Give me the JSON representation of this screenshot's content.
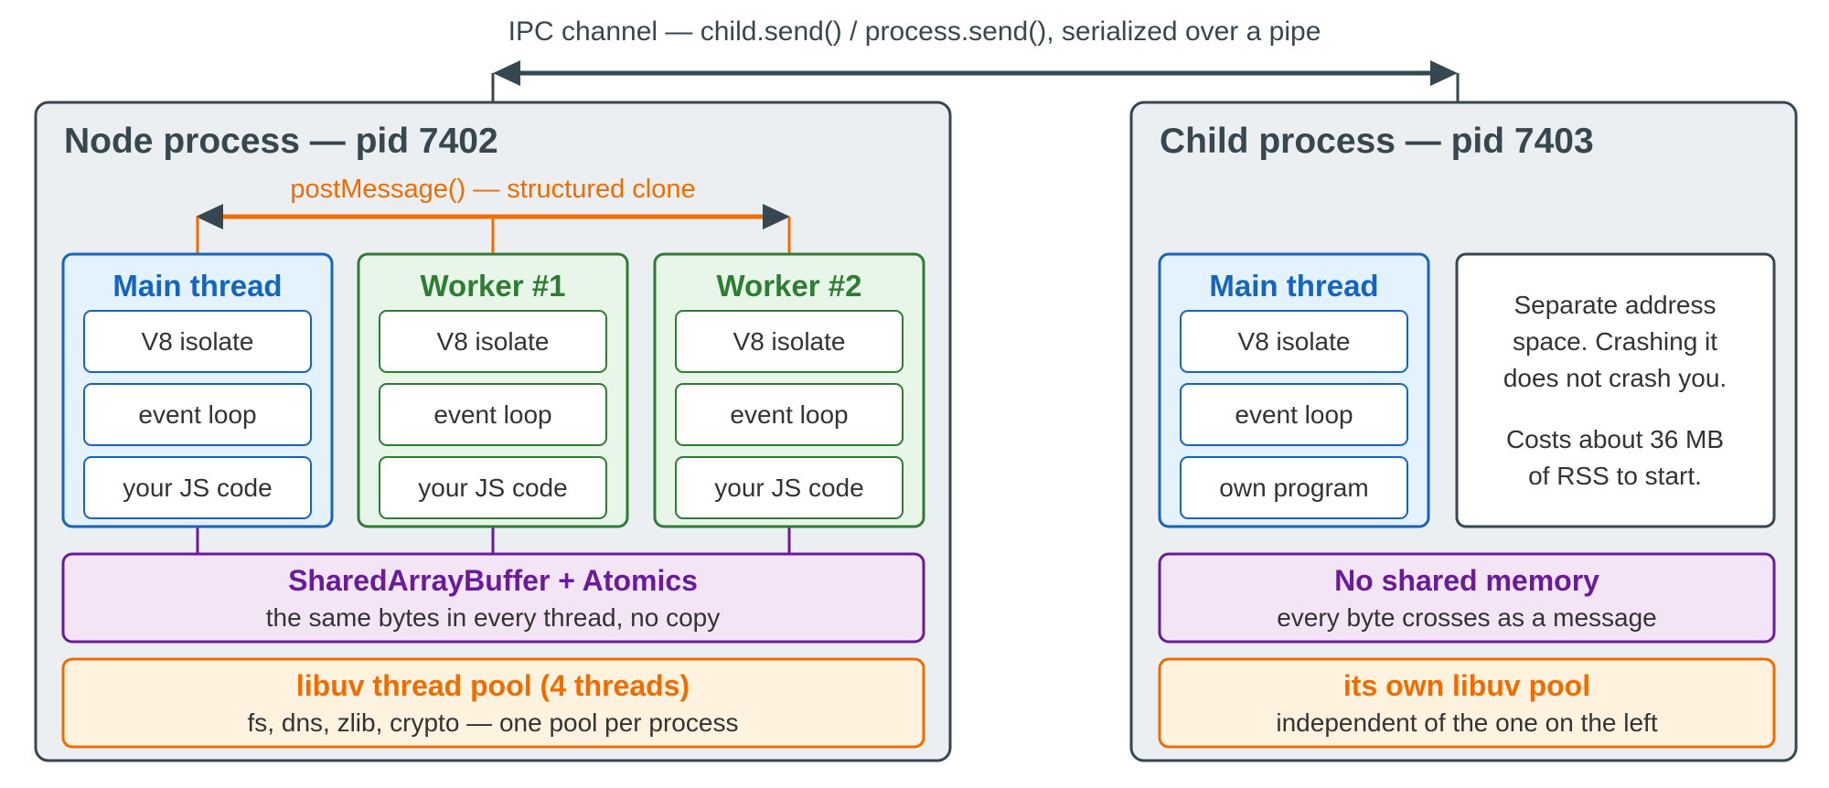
{
  "ipc_label": "IPC channel — child.send() / process.send(), serialized over a pipe",
  "postmessage_label": "postMessage() — structured clone",
  "node_process": {
    "title": "Node process — pid 7402",
    "threads": [
      {
        "title": "Main thread",
        "items": [
          "V8 isolate",
          "event loop",
          "your JS code"
        ]
      },
      {
        "title": "Worker #1",
        "items": [
          "V8 isolate",
          "event loop",
          "your JS code"
        ]
      },
      {
        "title": "Worker #2",
        "items": [
          "V8 isolate",
          "event loop",
          "your JS code"
        ]
      }
    ],
    "shared_memory": {
      "title": "SharedArrayBuffer + Atomics",
      "subtitle": "the same bytes in every thread, no copy"
    },
    "thread_pool": {
      "title": "libuv thread pool (4 threads)",
      "subtitle": "fs, dns, zlib, crypto — one pool per process"
    }
  },
  "child_process": {
    "title": "Child process — pid 7403",
    "main_thread": {
      "title": "Main thread",
      "items": [
        "V8 isolate",
        "event loop",
        "own program"
      ]
    },
    "note": {
      "para1": [
        "Separate address",
        "space. Crashing it",
        "does not crash you."
      ],
      "para2": [
        "Costs about 36 MB",
        "of RSS to start."
      ]
    },
    "shared_memory": {
      "title": "No shared memory",
      "subtitle": "every byte crosses as a message"
    },
    "thread_pool": {
      "title": "its own libuv pool",
      "subtitle": "independent of the one on the left"
    }
  },
  "colors": {
    "process_bg": "#eceff1",
    "process_border": "#37474f",
    "main_thread": "#1565c0",
    "main_thread_bg": "#e3f2fd",
    "worker": "#2e7d32",
    "worker_bg": "#e8f5e9",
    "shared": "#6a1b9a",
    "shared_bg": "#f3e5f5",
    "pool": "#ef6c00",
    "pool_bg": "#fff3e0"
  }
}
